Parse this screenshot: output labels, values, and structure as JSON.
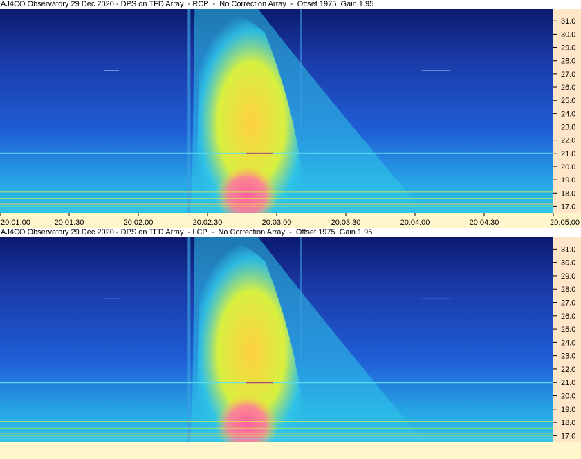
{
  "panels": [
    {
      "title": "AJ4CO Observatory 29 Dec 2020 - DPS on TFD Array  - RCP  -  No Correction Array  -  Offset 1975  Gain 1.95"
    },
    {
      "title": "AJ4CO Observatory 29 Dec 2020 - DPS on TFD Array  - LCP  -  No Correction Array  -  Offset 1975  Gain 1.95"
    }
  ],
  "chart_data": {
    "type": "heatmap",
    "x_ticks": [
      "20:01:00",
      "20:01:30",
      "20:02:00",
      "20:02:30",
      "20:03:00",
      "20:03:30",
      "20:04:00",
      "20:04:30",
      "20:05:00"
    ],
    "y_ticks": [
      "17.0",
      "18.0",
      "19.0",
      "20.0",
      "21.0",
      "22.0",
      "23.0",
      "24.0",
      "25.0",
      "26.0",
      "27.0",
      "28.0",
      "29.0",
      "30.0",
      "31.0"
    ],
    "xlim": [
      "20:01:00",
      "20:05:00"
    ],
    "ylim": [
      16.5,
      31.9
    ],
    "colormap": [
      "#0a1a6e",
      "#1f5fd6",
      "#2fc6e8",
      "#d8f040",
      "#ffd040",
      "#ff60a0"
    ],
    "burst": {
      "start": "20:02:25",
      "peak": "20:02:35",
      "peak_freq_low": 17.0,
      "peak_freq_high": 19.5
    },
    "colors": {
      "axis_bg": "#ffe6c8",
      "time_axis_bg": "#fff6cc"
    }
  }
}
